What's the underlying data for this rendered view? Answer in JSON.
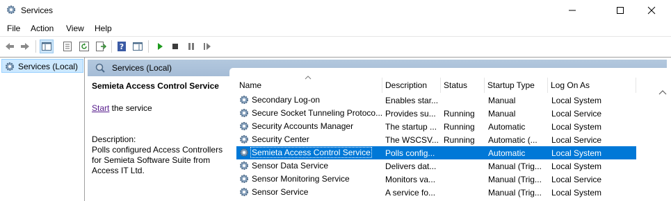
{
  "window": {
    "title": "Services"
  },
  "menu": {
    "file": "File",
    "action": "Action",
    "view": "View",
    "help": "Help"
  },
  "toolbar": {
    "buttons": [
      "back-icon",
      "forward-icon",
      "show-hide-console-tree-icon",
      "properties-icon",
      "refresh-icon",
      "export-list-icon",
      "help-icon",
      "show-hide-action-pane-icon",
      "start-service-icon",
      "stop-service-icon",
      "pause-service-icon",
      "restart-service-icon"
    ]
  },
  "tree": {
    "selected": "Services (Local)"
  },
  "panel": {
    "header": "Services (Local)"
  },
  "details": {
    "service_name": "Semieta Access Control Service",
    "start_link": "Start",
    "start_suffix": " the service",
    "description_label": "Description:",
    "description": "Polls configured Access Controllers for Semieta Software Suite from Access IT Ltd."
  },
  "list": {
    "columns": {
      "name": "Name",
      "description": "Description",
      "status": "Status",
      "startup": "Startup Type",
      "logon": "Log On As"
    },
    "rows": [
      {
        "name": "Secondary Log-on",
        "description": "Enables star...",
        "status": "",
        "startup": "Manual",
        "logon": "Local System"
      },
      {
        "name": "Secure Socket Tunneling Protoco...",
        "description": "Provides su...",
        "status": "Running",
        "startup": "Manual",
        "logon": "Local Service"
      },
      {
        "name": "Security Accounts Manager",
        "description": "The startup ...",
        "status": "Running",
        "startup": "Automatic",
        "logon": "Local System"
      },
      {
        "name": "Security Center",
        "description": "The WSCSV...",
        "status": "Running",
        "startup": "Automatic (...",
        "logon": "Local Service"
      },
      {
        "name": "Semieta Access Control Service",
        "description": "Polls config...",
        "status": "",
        "startup": "Automatic",
        "logon": "Local System",
        "selected": true
      },
      {
        "name": "Sensor Data Service",
        "description": "Delivers dat...",
        "status": "",
        "startup": "Manual (Trig...",
        "logon": "Local System"
      },
      {
        "name": "Sensor Monitoring Service",
        "description": "Monitors va...",
        "status": "",
        "startup": "Manual (Trig...",
        "logon": "Local Service"
      },
      {
        "name": "Sensor Service",
        "description": "A service fo...",
        "status": "",
        "startup": "Manual (Trig...",
        "logon": "Local System"
      }
    ]
  },
  "colors": {
    "selection": "#0078d7",
    "header_band": "#a9bfd8",
    "tree_selection": "#cce8ff",
    "link_visited": "#551a8b"
  }
}
